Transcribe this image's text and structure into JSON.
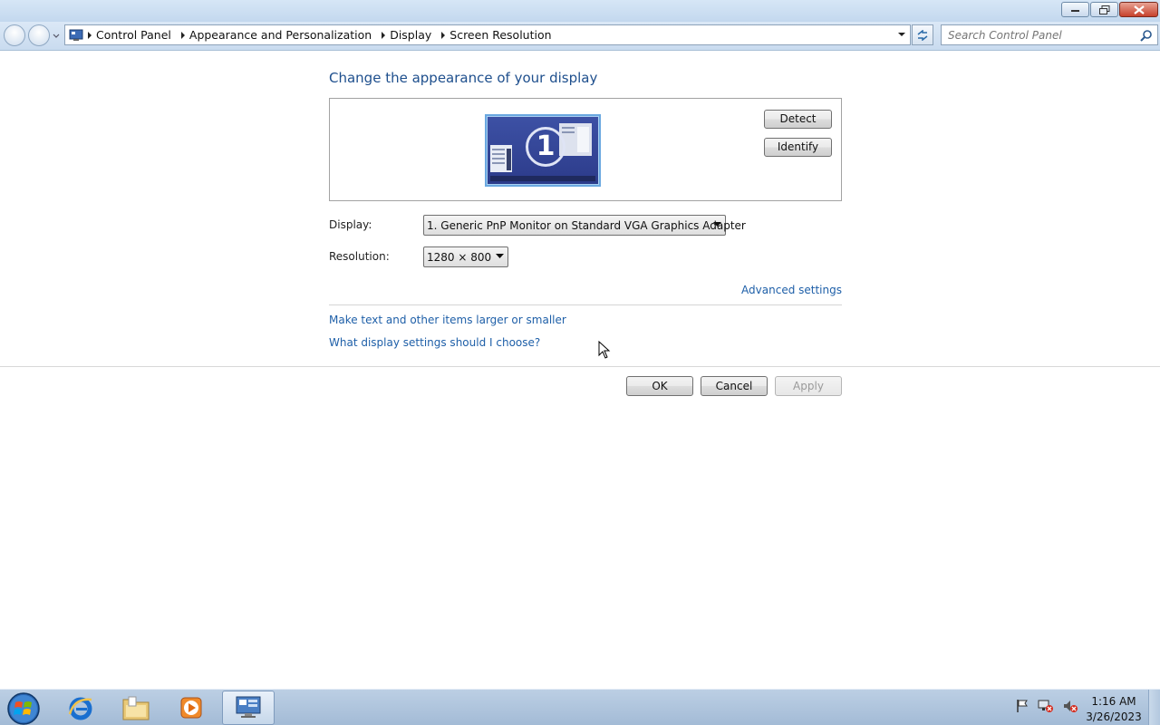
{
  "window": {
    "buttons": {
      "minimize_icon": "minimize-icon",
      "restore_icon": "restore-icon",
      "close_icon": "close-icon"
    }
  },
  "address_bar": {
    "breadcrumbs": [
      "Control Panel",
      "Appearance and Personalization",
      "Display",
      "Screen Resolution"
    ],
    "search_placeholder": "Search Control Panel"
  },
  "main": {
    "heading": "Change the appearance of your display",
    "monitor_number": "1",
    "detect_label": "Detect",
    "identify_label": "Identify",
    "display_label": "Display:",
    "display_value": "1. Generic PnP Monitor on Standard VGA Graphics Adapter",
    "resolution_label": "Resolution:",
    "resolution_value": "1280 × 800",
    "advanced_link": "Advanced settings",
    "larger_link": "Make text and other items larger or smaller",
    "which_link": "What display settings should I choose?"
  },
  "footer": {
    "ok_label": "OK",
    "cancel_label": "Cancel",
    "apply_label": "Apply"
  },
  "taskbar": {
    "items": [
      "start-button",
      "internet-explorer",
      "windows-explorer",
      "windows-media-player",
      "control-panel"
    ],
    "time": "1:16 AM",
    "date": "3/26/2023"
  },
  "colors": {
    "heading": "#1e4f8d",
    "link": "#1e5fa8",
    "taskbar": "#a3bbd6"
  }
}
